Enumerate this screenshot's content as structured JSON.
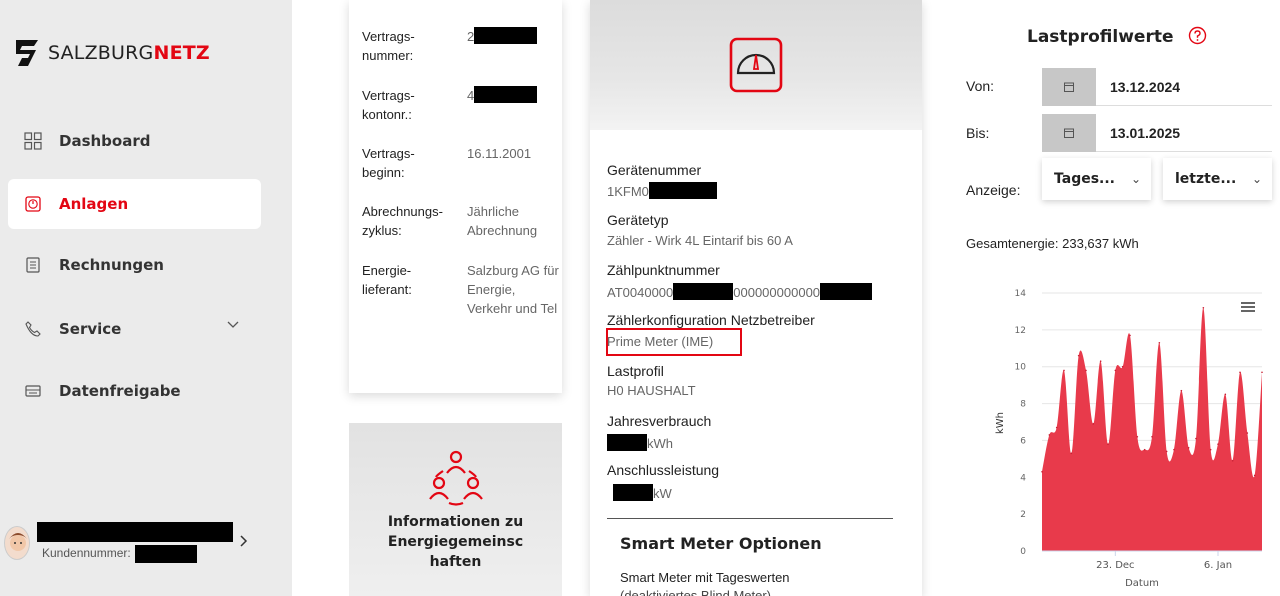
{
  "brand": {
    "prefix": "SALZBURG",
    "suffix": "NETZ"
  },
  "nav": [
    {
      "label": "Dashboard",
      "icon": "grid-icon",
      "active": false
    },
    {
      "label": "Anlagen",
      "icon": "meter-icon",
      "active": true
    },
    {
      "label": "Rechnungen",
      "icon": "invoice-icon",
      "active": false
    },
    {
      "label": "Service",
      "icon": "phone-icon",
      "active": false
    },
    {
      "label": "Datenfreigabe",
      "icon": "share-icon",
      "active": false
    }
  ],
  "user": {
    "customer_label": "Kundennummer:"
  },
  "contract": {
    "number_label": "Vertrags-\nnummer:",
    "number_value": "2",
    "account_label": "Vertrags-\nkontonr.:",
    "account_value": "4",
    "start_label": "Vertrags-\nbeginn:",
    "start_value": "16.11.2001",
    "cycle_label": "Abrechnungs-\nzyklus:",
    "cycle_value": "Jährliche Abrechnung",
    "supplier_label": "Energie-\nlieferant:",
    "supplier_value": "Salzburg AG für Energie, Verkehr und Tel"
  },
  "info_card": {
    "title": "Informationen zu Energiegemeinsc haften"
  },
  "device": {
    "device_number_label": "Gerätenummer",
    "device_number_value": "1KFM0",
    "device_type_label": "Gerätetyp",
    "device_type_value": "Zähler - Wirk 4L Eintarif bis 60 A",
    "meter_point_label": "Zählpunktnummer",
    "meter_point_prefix": "AT0040000",
    "meter_point_mid": "000000000000",
    "config_label": "Zählerkonfiguration Netzbetreiber",
    "config_value": "Prime Meter (IME)",
    "load_profile_label": "Lastprofil",
    "load_profile_value": "H0 HAUSHALT",
    "annual_label": "Jahresverbrauch",
    "annual_unit": "kWh",
    "connection_label": "Anschlussleistung",
    "connection_unit": "kW",
    "smart_title": "Smart Meter Optionen",
    "smart_sub": "Smart Meter mit Tageswerten",
    "smart_sub2": "(deaktiviertes Blind Meter)"
  },
  "load_profile": {
    "title": "Lastprofilwerte",
    "from_label": "Von:",
    "from_value": "13.12.2024",
    "to_label": "Bis:",
    "to_value": "13.01.2025",
    "display_label": "Anzeige:",
    "select1": "Tages...",
    "select2": "letzte...",
    "total_label": "Gesamtenergie:",
    "total_value": "233,637 kWh"
  },
  "colors": {
    "brand_red": "#e30613",
    "chart_fill": "#e83a4b",
    "sidebar_bg": "#ebebeb"
  },
  "chart_data": {
    "type": "area",
    "xlabel": "Datum",
    "ylabel": "kWh",
    "ylim": [
      0,
      14
    ],
    "yticks": [
      0,
      2,
      4,
      6,
      8,
      10,
      12,
      14
    ],
    "x_tick_labels": [
      "23. Dec",
      "6. Jan"
    ],
    "x_tick_index": [
      10,
      24
    ],
    "values": [
      4.3,
      6.3,
      6.7,
      9.8,
      5.3,
      10.6,
      9.8,
      6.9,
      10.3,
      5.8,
      9.8,
      10.0,
      11.7,
      6.2,
      5.5,
      6.2,
      11.3,
      5.4,
      5.5,
      8.7,
      5.6,
      6.1,
      13.2,
      5.5,
      5.8,
      8.5,
      4.9,
      9.7,
      6.4,
      4.1,
      9.7
    ]
  }
}
